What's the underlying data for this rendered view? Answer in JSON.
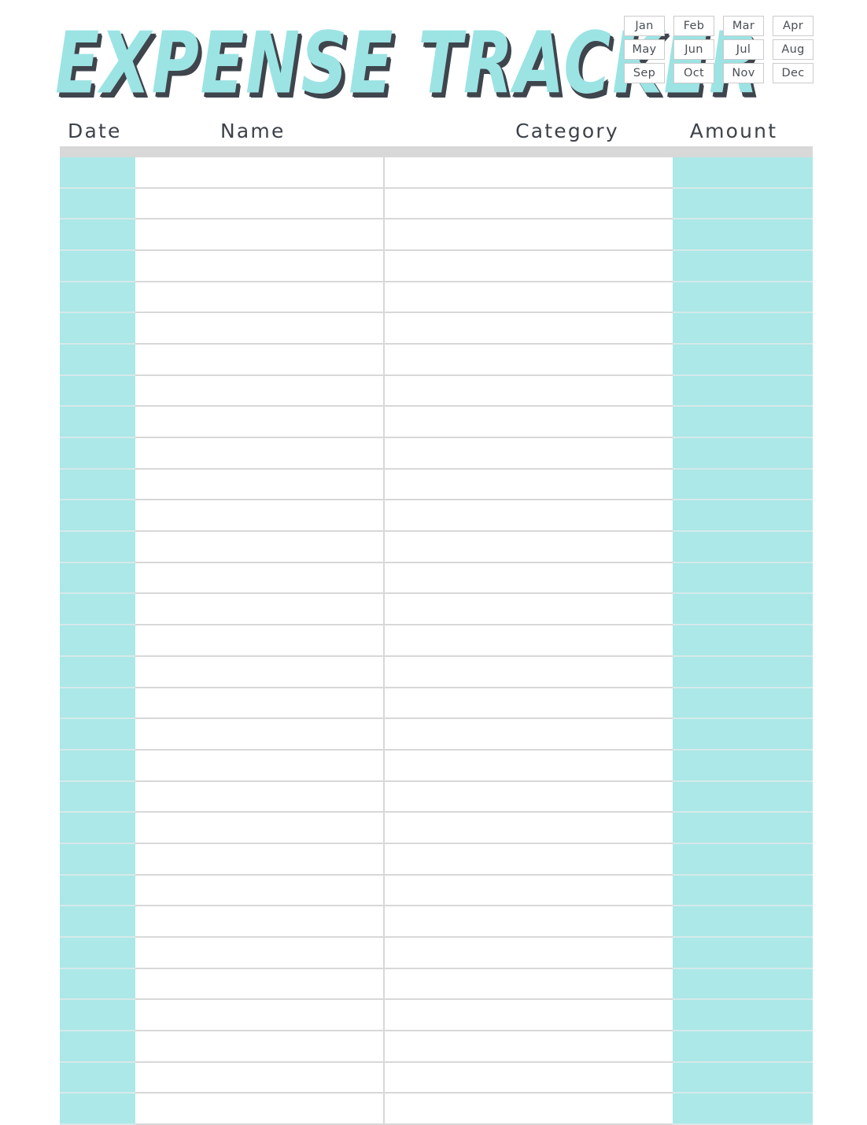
{
  "document": {
    "title": "Expense Tracker",
    "type": "printable-expense-tracker"
  },
  "header": {
    "title": "Expense Tracker"
  },
  "month_selector": {
    "name": "month-selector",
    "months": [
      {
        "label": "Jan",
        "selected": false
      },
      {
        "label": "Feb",
        "selected": false
      },
      {
        "label": "Mar",
        "selected": false
      },
      {
        "label": "Apr",
        "selected": false
      },
      {
        "label": "May",
        "selected": false
      },
      {
        "label": "Jun",
        "selected": false
      },
      {
        "label": "Jul",
        "selected": false
      },
      {
        "label": "Aug",
        "selected": false
      },
      {
        "label": "Sep",
        "selected": false
      },
      {
        "label": "Oct",
        "selected": false
      },
      {
        "label": "Nov",
        "selected": false
      },
      {
        "label": "Dec",
        "selected": false
      }
    ]
  },
  "table": {
    "columns": [
      {
        "key": "date",
        "label": "Date",
        "fill": "cyan"
      },
      {
        "key": "name",
        "label": "Name",
        "fill": "white"
      },
      {
        "key": "category",
        "label": "Category",
        "fill": "white"
      },
      {
        "key": "amount",
        "label": "Amount",
        "fill": "cyan"
      }
    ],
    "row_count": 31,
    "rows": []
  },
  "colors": {
    "accent_cyan": "#ace8e8",
    "title_text": "#9ce3e4",
    "title_shadow": "#3f454c",
    "header_text": "#3d4249",
    "grid_line": "#d8d8d8",
    "grid_line_cyan": "#d6e9e9",
    "month_border": "#cbcbcb",
    "month_text": "#494f56",
    "page_background": "#ffffff"
  }
}
